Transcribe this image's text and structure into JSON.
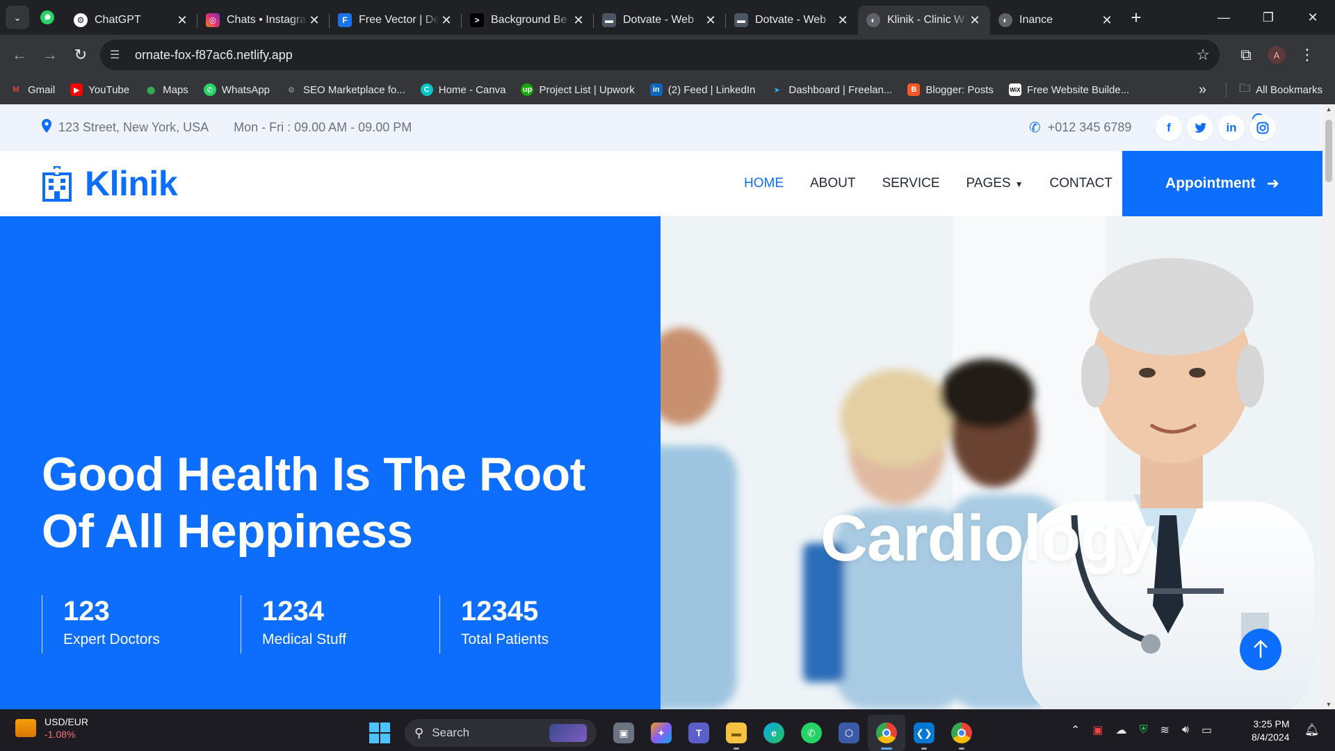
{
  "browser": {
    "tabs": [
      {
        "title": "ChatGPT",
        "icon": "chatgpt-icon",
        "color": "#202124"
      },
      {
        "title": "Chats • Instagram",
        "icon": "instagram-icon",
        "color": "#e1306c"
      },
      {
        "title": "Free Vector | De",
        "icon": "freepik-icon",
        "color": "#1a73e8"
      },
      {
        "title": "Background Be",
        "icon": "terminal-icon",
        "color": "#111111"
      },
      {
        "title": "Dotvate - Web",
        "icon": "site-icon",
        "color": "#3c4043"
      },
      {
        "title": "Dotvate - Web",
        "icon": "site-icon",
        "color": "#3c4043"
      },
      {
        "title": "Klinik - Clinic W",
        "icon": "globe-icon",
        "color": "#5f6368"
      },
      {
        "title": "Inance",
        "icon": "globe-icon",
        "color": "#5f6368"
      }
    ],
    "url": "ornate-fox-f87ac6.netlify.app",
    "profile_initial": "A",
    "bookmarks": [
      {
        "label": "Gmail",
        "icon": "gmail-icon",
        "color": "#ea4335"
      },
      {
        "label": "YouTube",
        "icon": "youtube-icon",
        "color": "#ff0000"
      },
      {
        "label": "Maps",
        "icon": "maps-icon",
        "color": "#34a853"
      },
      {
        "label": "WhatsApp",
        "icon": "whatsapp-icon",
        "color": "#25d366"
      },
      {
        "label": "SEO Marketplace fo...",
        "icon": "seo-icon",
        "color": "#7b8794"
      },
      {
        "label": "Home - Canva",
        "icon": "canva-icon",
        "color": "#00c4cc"
      },
      {
        "label": "Project List | Upwork",
        "icon": "upwork-icon",
        "color": "#14a800"
      },
      {
        "label": "(2) Feed | LinkedIn",
        "icon": "linkedin-icon",
        "color": "#0a66c2"
      },
      {
        "label": "Dashboard | Freelan...",
        "icon": "freelancer-icon",
        "color": "#29b2fe"
      },
      {
        "label": "Blogger: Posts",
        "icon": "blogger-icon",
        "color": "#ff5722"
      },
      {
        "label": "Free Website Builde...",
        "icon": "wix-icon",
        "color": "#ffffff"
      }
    ],
    "all_bookmarks": "All Bookmarks"
  },
  "site": {
    "topbar": {
      "address": "123 Street, New York, USA",
      "hours": "Mon - Fri : 09.00 AM - 09.00 PM",
      "phone": "+012 345 6789",
      "socials": [
        "facebook-icon",
        "twitter-icon",
        "linkedin-icon",
        "instagram-icon"
      ]
    },
    "brand": "Klinik",
    "nav": {
      "home": "HOME",
      "about": "ABOUT",
      "service": "SERVICE",
      "pages": "PAGES",
      "contact": "CONTACT"
    },
    "appointment": "Appointment",
    "hero": {
      "title_line1": "Good Health Is The Root",
      "title_line2": "Of All Heppiness",
      "stats": [
        {
          "value": "123",
          "label": "Expert Doctors"
        },
        {
          "value": "1234",
          "label": "Medical Stuff"
        },
        {
          "value": "12345",
          "label": "Total Patients"
        }
      ],
      "slide_caption": "Cardiology"
    },
    "colors": {
      "primary": "#0d6efd",
      "topbar_bg": "#eef3fc"
    }
  },
  "taskbar": {
    "ticker_symbol": "USD/EUR",
    "ticker_change": "-1.08%",
    "search_label": "Search",
    "time": "3:25 PM",
    "date": "8/4/2024"
  }
}
